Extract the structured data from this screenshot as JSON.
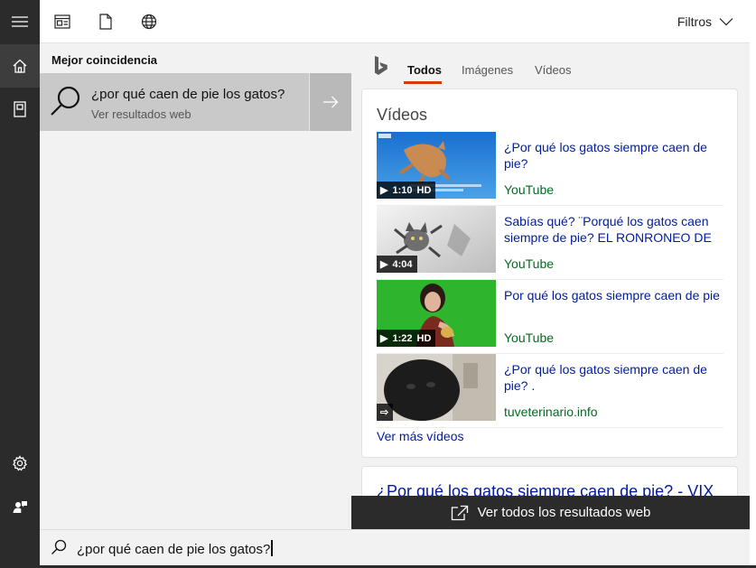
{
  "topbar": {
    "filters_label": "Filtros",
    "icons": [
      "apps-icon",
      "document-icon",
      "globe-icon"
    ]
  },
  "rail": {
    "top_icons": [
      "hamburger-icon",
      "home-icon",
      "notebook-icon"
    ],
    "bottom_icons": [
      "gear-icon",
      "feedback-icon"
    ]
  },
  "best_match": {
    "section_title": "Mejor coincidencia",
    "title": "¿por qué caen de pie los gatos?",
    "subtitle": "Ver resultados web"
  },
  "preview": {
    "tabs": [
      {
        "label": "Todos",
        "active": true
      },
      {
        "label": "Imágenes",
        "active": false
      },
      {
        "label": "Vídeos",
        "active": false
      }
    ],
    "videos_card": {
      "title": "Vídeos",
      "items": [
        {
          "title": "¿Por qué los gatos siempre caen de pie?",
          "source": "YouTube",
          "duration": "1:10",
          "hd": "HD"
        },
        {
          "title": "Sabías qué? ¨Porqué los gatos caen siempre de pie? EL RONRONEO DE",
          "source": "YouTube",
          "duration": "4:04",
          "hd": ""
        },
        {
          "title": "Por qué los gatos siempre caen de pie",
          "source": "YouTube",
          "duration": "1:22",
          "hd": "HD"
        },
        {
          "title": "¿Por qué los gatos siempre caen de pie? .",
          "source": "tuveterinario.info",
          "duration": "",
          "hd": ""
        }
      ],
      "more_label": "Ver más vídeos"
    },
    "web_card": {
      "title": "¿Por qué los gatos siempre caen de pie? - VIX"
    },
    "see_all_label": "Ver todos los resultados web"
  },
  "search": {
    "query": "¿por qué caen de pie los gatos?"
  },
  "colors": {
    "rail_bg": "#2b2b2b",
    "tab_accent": "#d83b01",
    "link": "#001ba0",
    "source": "#006d21",
    "selected": "#c9c9c9"
  }
}
